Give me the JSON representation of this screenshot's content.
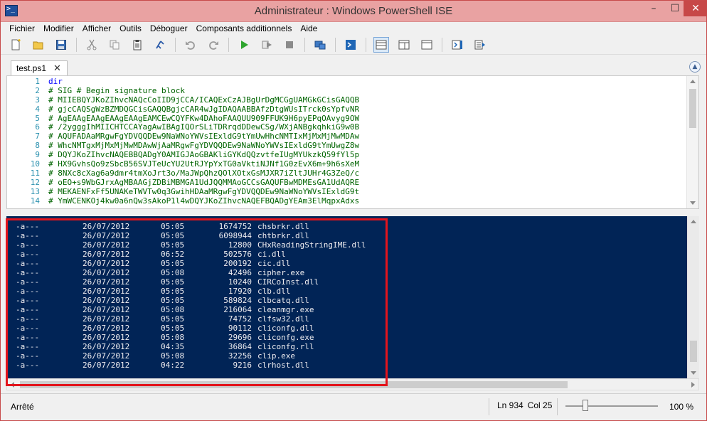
{
  "window": {
    "title": "Administrateur : Windows PowerShell ISE",
    "minimize": "–",
    "maximize": "☐",
    "close": "✕"
  },
  "menu": [
    "Fichier",
    "Modifier",
    "Afficher",
    "Outils",
    "Déboguer",
    "Composants additionnels",
    "Aide"
  ],
  "toolbar_icons": [
    "new-file-icon",
    "open-folder-icon",
    "save-icon",
    "cut-icon",
    "copy-icon",
    "paste-icon",
    "clear-console-icon",
    "undo-icon",
    "redo-icon",
    "run-script-icon",
    "run-selection-icon",
    "stop-icon",
    "remote-powershell-icon",
    "start-powershell-icon",
    "show-script-pane-top-icon",
    "show-script-pane-right-icon",
    "show-script-pane-max-icon",
    "show-command-window-icon",
    "show-command-addon-icon"
  ],
  "tab": {
    "label": "test.ps1",
    "close": "✕"
  },
  "editor": {
    "line_numbers": [
      "1",
      "2",
      "3",
      "4",
      "5",
      "6",
      "7",
      "8",
      "9",
      "10",
      "11",
      "12",
      "13",
      "14"
    ],
    "lines": [
      "dir",
      "# SIG # Begin signature block",
      "# MIIEBQYJKoZIhvcNAQcCoIID9jCCA/ICAQExCzAJBgUrDgMCGgUAMGkGCisGAQQB",
      "# gjcCAQSgWzBZMDQGCisGAQQBgjcCAR4wJgIDAQAABBAfzDtgWUsITrck0sYpfvNR",
      "# AgEAAgEAAgEAAgEAAgEAMCEwCQYFKw4DAhoFAAQUU909FFUK9H6pyEPqOAvyg9OW",
      "# /2ygggIhMIICHTCCAYagAwIBAgIQOrSLiTDRrqdDDewCSg/WXjANBgkqhkiG9w0B",
      "# AQUFADAaMRgwFgYDVQQDEw9NaWNoYWVsIExldG9tYmUwHhcNMTIxMjMxMjMwMDAw",
      "# WhcNMTgxMjMxMjMwMDAwWjAaMRgwFgYDVQQDEw9NaWNoYWVsIExldG9tYmUwgZ8w",
      "# DQYJKoZIhvcNAQEBBQADgY0AMIGJAoGBAKliGYKdQQzvtfeIUgMYUkzkQ59fYl5p",
      "# HX9GvhsQo9zSbcB56SVJTeUcYU2UtRJYpYxTG0aVktiNJNf1G0zEvX6m+9h6sXeM",
      "# 8NXc8cXag6a9dmr4tmXoJrt3o/MaJWpQhzQOlXOtxGsMJXR7iZltJUHr4G3ZeQ/c",
      "# oEO+s9WbGJrxAgMBAAGjZDBiMBMGA1UdJQQMMAoGCCsGAQUFBwMDMEsGA1UdAQRE",
      "# MEKAENFxFf5UNAKeTWVTw0q3GwihHDAaMRgwFgYDVQQDEw9NaWNoYWVsIExldG9t",
      "# YmWCENKOj4kw0a6nQw3sAkoP1l4wDQYJKoZIhvcNAQEFBQADgYEAm3ElMqpxAdxs"
    ]
  },
  "console": {
    "rows": [
      {
        "mode": "-a---",
        "date": "26/07/2012",
        "time": "05:05",
        "size": "1674752",
        "name": "chsbrkr.dll"
      },
      {
        "mode": "-a---",
        "date": "26/07/2012",
        "time": "05:05",
        "size": "6098944",
        "name": "chtbrkr.dll"
      },
      {
        "mode": "-a---",
        "date": "26/07/2012",
        "time": "05:05",
        "size": "12800",
        "name": "CHxReadingStringIME.dll"
      },
      {
        "mode": "-a---",
        "date": "26/07/2012",
        "time": "06:52",
        "size": "502576",
        "name": "ci.dll"
      },
      {
        "mode": "-a---",
        "date": "26/07/2012",
        "time": "05:05",
        "size": "200192",
        "name": "cic.dll"
      },
      {
        "mode": "-a---",
        "date": "26/07/2012",
        "time": "05:08",
        "size": "42496",
        "name": "cipher.exe"
      },
      {
        "mode": "-a---",
        "date": "26/07/2012",
        "time": "05:05",
        "size": "10240",
        "name": "CIRCoInst.dll"
      },
      {
        "mode": "-a---",
        "date": "26/07/2012",
        "time": "05:05",
        "size": "17920",
        "name": "clb.dll"
      },
      {
        "mode": "-a---",
        "date": "26/07/2012",
        "time": "05:05",
        "size": "589824",
        "name": "clbcatq.dll"
      },
      {
        "mode": "-a---",
        "date": "26/07/2012",
        "time": "05:08",
        "size": "216064",
        "name": "cleanmgr.exe"
      },
      {
        "mode": "-a---",
        "date": "26/07/2012",
        "time": "05:05",
        "size": "74752",
        "name": "clfsw32.dll"
      },
      {
        "mode": "-a---",
        "date": "26/07/2012",
        "time": "05:05",
        "size": "90112",
        "name": "cliconfg.dll"
      },
      {
        "mode": "-a---",
        "date": "26/07/2012",
        "time": "05:08",
        "size": "29696",
        "name": "cliconfg.exe"
      },
      {
        "mode": "-a---",
        "date": "26/07/2012",
        "time": "04:35",
        "size": "36864",
        "name": "cliconfg.rll"
      },
      {
        "mode": "-a---",
        "date": "26/07/2012",
        "time": "05:08",
        "size": "32256",
        "name": "clip.exe"
      },
      {
        "mode": "-a---",
        "date": "26/07/2012",
        "time": "04:22",
        "size": "9216",
        "name": "clrhost.dll"
      }
    ]
  },
  "status": {
    "text": "Arrêté",
    "ln": "Ln 934",
    "col": "Col 25",
    "zoom_value": "100 %",
    "zoom_level": 1.0
  },
  "colors": {
    "console_bg": "#012456",
    "highlight": "#e3141c",
    "title_bar": "#e9a2a2"
  }
}
